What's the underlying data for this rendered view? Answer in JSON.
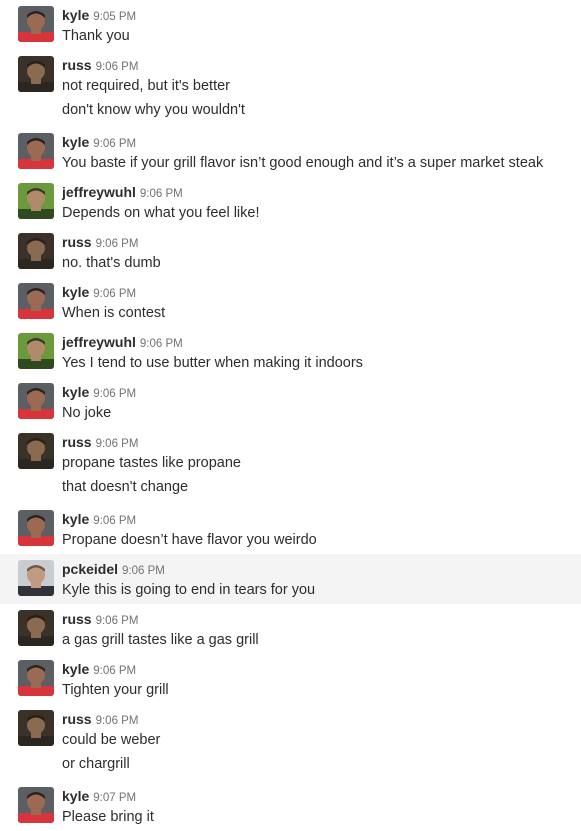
{
  "messages": [
    {
      "user": "kyle",
      "time": "9:05 PM",
      "text": "Thank you"
    },
    {
      "user": "russ",
      "time": "9:06 PM",
      "text": "not required, but it's better"
    },
    {
      "continuation": true,
      "text": "don't know why you wouldn't"
    },
    {
      "user": "kyle",
      "time": "9:06 PM",
      "text": "You baste if your grill flavor isn’t good enough and it’s a super market steak"
    },
    {
      "user": "jeffreywuhl",
      "time": "9:06 PM",
      "text": "Depends on what you feel like!"
    },
    {
      "user": "russ",
      "time": "9:06 PM",
      "text": "no. that's dumb"
    },
    {
      "user": "kyle",
      "time": "9:06 PM",
      "text": "When is contest"
    },
    {
      "user": "jeffreywuhl",
      "time": "9:06 PM",
      "text": "Yes I tend to use butter when making it indoors"
    },
    {
      "user": "kyle",
      "time": "9:06 PM",
      "text": "No joke"
    },
    {
      "user": "russ",
      "time": "9:06 PM",
      "text": "propane tastes like propane"
    },
    {
      "continuation": true,
      "text": "that doesn't change"
    },
    {
      "user": "kyle",
      "time": "9:06 PM",
      "text": "Propane doesn’t have flavor you weirdo"
    },
    {
      "user": "pckeidel",
      "time": "9:06 PM",
      "text": "Kyle this is going to end in tears for you",
      "highlighted": true
    },
    {
      "user": "russ",
      "time": "9:06 PM",
      "text": "a gas grill tastes like a gas grill"
    },
    {
      "user": "kyle",
      "time": "9:06 PM",
      "text": "Tighten your grill"
    },
    {
      "user": "russ",
      "time": "9:06 PM",
      "text": "could be weber"
    },
    {
      "continuation": true,
      "text": "or chargrill"
    },
    {
      "user": "kyle",
      "time": "9:07 PM",
      "text": "Please bring it"
    }
  ],
  "avatars": {
    "kyle": {
      "bg": "#5b5f64",
      "shirt": "#d8343c",
      "skin": "#9a6a52",
      "hair": "#2a2220"
    },
    "russ": {
      "bg": "#3a3128",
      "shirt": "#2b2620",
      "skin": "#8a6a50",
      "hair": "#2a1e16"
    },
    "jeffreywuhl": {
      "bg": "#6b9a3c",
      "shirt": "#2f4a20",
      "skin": "#b08a6a",
      "hair": "#3a3a2a"
    },
    "pckeidel": {
      "bg": "#c9ccd0",
      "shirt": "#2f3238",
      "skin": "#c29a80",
      "hair": "#6a5a4a"
    }
  }
}
